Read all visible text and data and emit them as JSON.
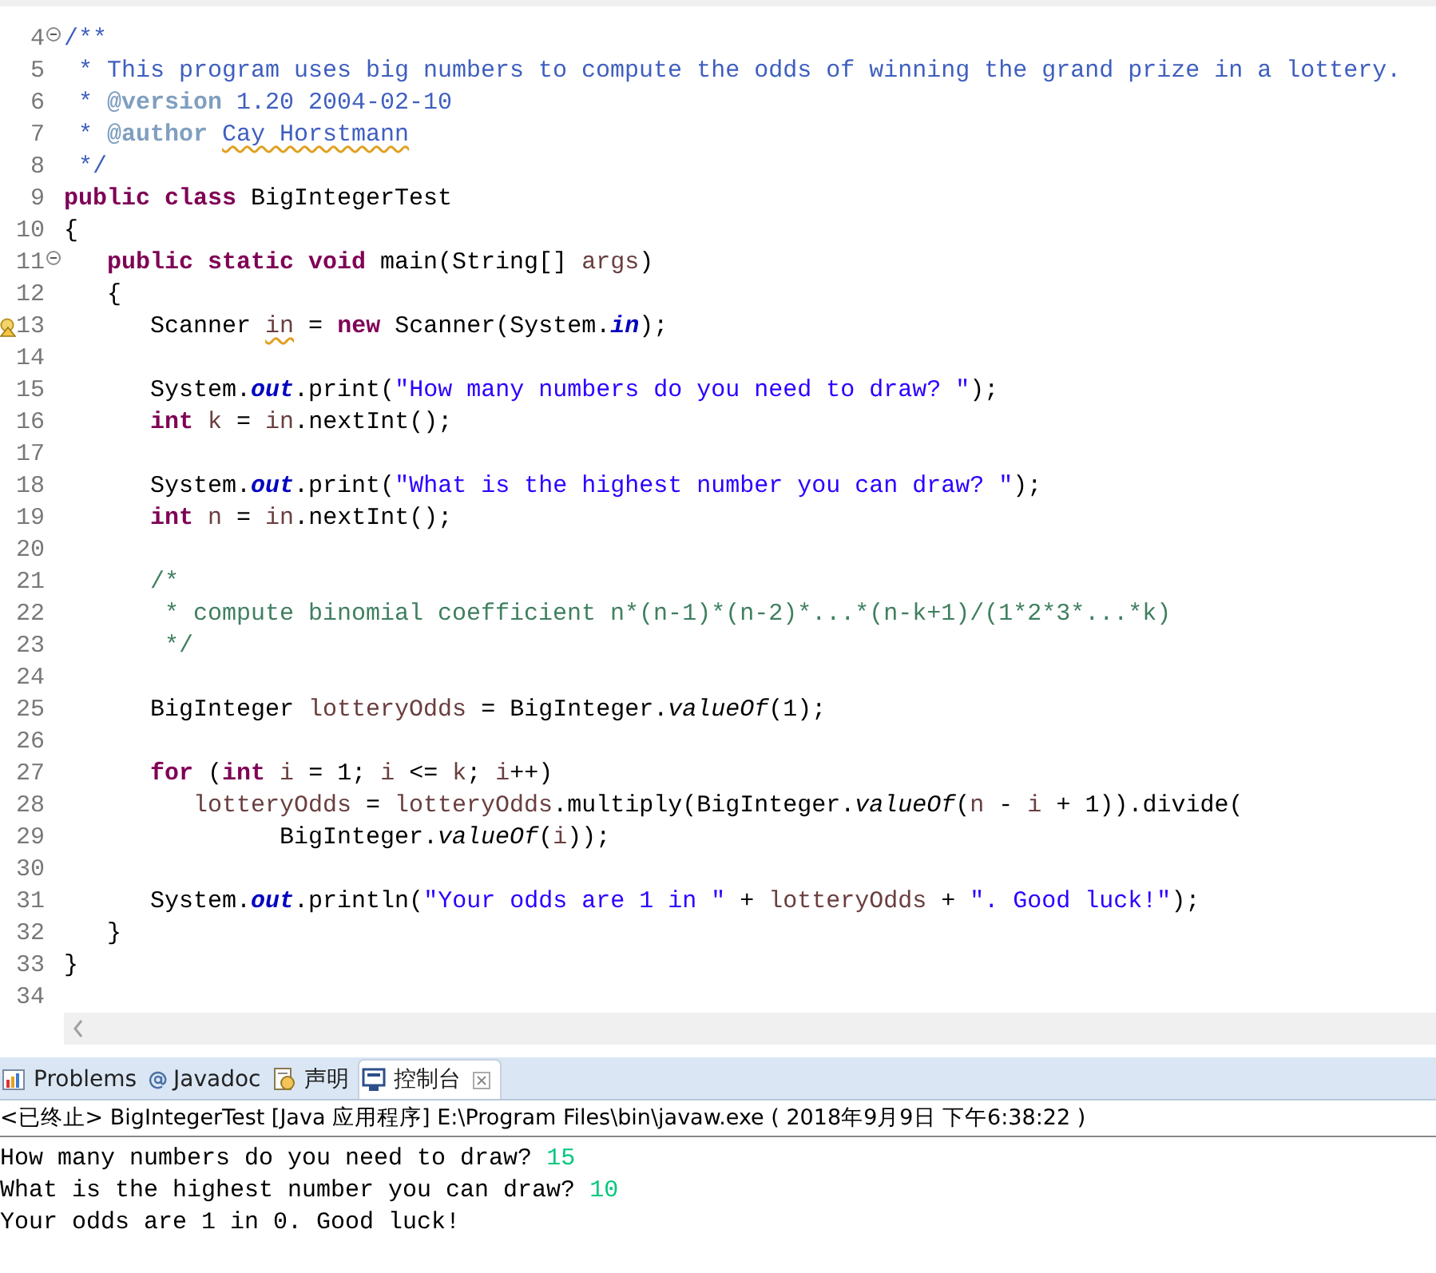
{
  "editor": {
    "lines": [
      {
        "number": "4",
        "fold": true,
        "warning": false,
        "tokens": [
          {
            "text": "/**",
            "kind": "doc"
          }
        ]
      },
      {
        "number": "5",
        "fold": false,
        "warning": false,
        "tokens": [
          {
            "text": " * This program uses big numbers to compute the odds of winning the grand prize in a lottery.",
            "kind": "doc"
          }
        ]
      },
      {
        "number": "6",
        "fold": false,
        "warning": false,
        "tokens": [
          {
            "text": " * ",
            "kind": "doc"
          },
          {
            "text": "@version",
            "kind": "doctag"
          },
          {
            "text": " 1.20 2004-02-10",
            "kind": "doc"
          }
        ]
      },
      {
        "number": "7",
        "fold": false,
        "warning": false,
        "tokens": [
          {
            "text": " * ",
            "kind": "doc"
          },
          {
            "text": "@author ",
            "kind": "doctag"
          },
          {
            "text": "Cay",
            "kind": "doc",
            "squiggle": true
          },
          {
            "text": " Horstmann",
            "kind": "doc",
            "squiggle": true
          }
        ]
      },
      {
        "number": "8",
        "fold": false,
        "warning": false,
        "tokens": [
          {
            "text": " */",
            "kind": "doc"
          }
        ]
      },
      {
        "number": "9",
        "fold": false,
        "warning": false,
        "tokens": [
          {
            "text": "public class",
            "kind": "keyword"
          },
          {
            "text": " BigIntegerTest",
            "kind": "plain"
          }
        ]
      },
      {
        "number": "10",
        "fold": false,
        "warning": false,
        "tokens": [
          {
            "text": "{",
            "kind": "plain"
          }
        ]
      },
      {
        "number": "11",
        "fold": true,
        "warning": false,
        "tokens": [
          {
            "text": "   public static void",
            "kind": "keyword"
          },
          {
            "text": " main(String[] ",
            "kind": "plain"
          },
          {
            "text": "args",
            "kind": "var"
          },
          {
            "text": ")",
            "kind": "plain"
          }
        ]
      },
      {
        "number": "12",
        "fold": false,
        "warning": false,
        "tokens": [
          {
            "text": "   {",
            "kind": "plain"
          }
        ]
      },
      {
        "number": "13",
        "fold": false,
        "warning": true,
        "tokens": [
          {
            "text": "      Scanner ",
            "kind": "plain"
          },
          {
            "text": "in",
            "kind": "var",
            "squiggle": true
          },
          {
            "text": " = ",
            "kind": "plain"
          },
          {
            "text": "new",
            "kind": "keyword"
          },
          {
            "text": " Scanner(System.",
            "kind": "plain"
          },
          {
            "text": "in",
            "kind": "field"
          },
          {
            "text": ");",
            "kind": "plain"
          }
        ]
      },
      {
        "number": "14",
        "fold": false,
        "warning": false
      },
      {
        "number": "15",
        "fold": false,
        "warning": false,
        "tokens": [
          {
            "text": "      System.",
            "kind": "plain"
          },
          {
            "text": "out",
            "kind": "field"
          },
          {
            "text": ".print(",
            "kind": "plain"
          },
          {
            "text": "\"How many numbers do you need to draw? \"",
            "kind": "string"
          },
          {
            "text": ");",
            "kind": "plain"
          }
        ]
      },
      {
        "number": "16",
        "fold": false,
        "warning": false,
        "tokens": [
          {
            "text": "      int",
            "kind": "keyword"
          },
          {
            "text": " k",
            "kind": "var"
          },
          {
            "text": " = ",
            "kind": "plain"
          },
          {
            "text": "in",
            "kind": "var"
          },
          {
            "text": ".nextInt();",
            "kind": "plain"
          }
        ]
      },
      {
        "number": "17",
        "fold": false,
        "warning": false
      },
      {
        "number": "18",
        "fold": false,
        "warning": false,
        "tokens": [
          {
            "text": "      System.",
            "kind": "plain"
          },
          {
            "text": "out",
            "kind": "field"
          },
          {
            "text": ".print(",
            "kind": "plain"
          },
          {
            "text": "\"What is the highest number you can draw? \"",
            "kind": "string"
          },
          {
            "text": ");",
            "kind": "plain"
          }
        ]
      },
      {
        "number": "19",
        "fold": false,
        "warning": false,
        "tokens": [
          {
            "text": "      int",
            "kind": "keyword"
          },
          {
            "text": " n",
            "kind": "var"
          },
          {
            "text": " = ",
            "kind": "plain"
          },
          {
            "text": "in",
            "kind": "var"
          },
          {
            "text": ".nextInt();",
            "kind": "plain"
          }
        ]
      },
      {
        "number": "20",
        "fold": false,
        "warning": false
      },
      {
        "number": "21",
        "fold": false,
        "warning": false,
        "tokens": [
          {
            "text": "      /*",
            "kind": "comment"
          }
        ]
      },
      {
        "number": "22",
        "fold": false,
        "warning": false,
        "tokens": [
          {
            "text": "       * compute binomial coefficient n*(n-1)*(n-2)*...*(n-k+1)/(1*2*3*...*k)",
            "kind": "comment"
          }
        ]
      },
      {
        "number": "23",
        "fold": false,
        "warning": false,
        "tokens": [
          {
            "text": "       */",
            "kind": "comment"
          }
        ]
      },
      {
        "number": "24",
        "fold": false,
        "warning": false
      },
      {
        "number": "25",
        "fold": false,
        "warning": false,
        "tokens": [
          {
            "text": "      BigInteger ",
            "kind": "plain"
          },
          {
            "text": "lotteryOdds",
            "kind": "var"
          },
          {
            "text": " = BigInteger.",
            "kind": "plain"
          },
          {
            "text": "valueOf",
            "kind": "static"
          },
          {
            "text": "(1);",
            "kind": "plain"
          }
        ]
      },
      {
        "number": "26",
        "fold": false,
        "warning": false
      },
      {
        "number": "27",
        "fold": false,
        "warning": false,
        "tokens": [
          {
            "text": "      for",
            "kind": "keyword"
          },
          {
            "text": " (",
            "kind": "plain"
          },
          {
            "text": "int",
            "kind": "keyword"
          },
          {
            "text": " i",
            "kind": "var"
          },
          {
            "text": " = 1; ",
            "kind": "plain"
          },
          {
            "text": "i",
            "kind": "var"
          },
          {
            "text": " <= ",
            "kind": "plain"
          },
          {
            "text": "k",
            "kind": "var"
          },
          {
            "text": "; ",
            "kind": "plain"
          },
          {
            "text": "i",
            "kind": "var"
          },
          {
            "text": "++)",
            "kind": "plain"
          }
        ]
      },
      {
        "number": "28",
        "fold": false,
        "warning": false,
        "tokens": [
          {
            "text": "         lotteryOdds",
            "kind": "var"
          },
          {
            "text": " = ",
            "kind": "plain"
          },
          {
            "text": "lotteryOdds",
            "kind": "var"
          },
          {
            "text": ".multiply(BigInteger.",
            "kind": "plain"
          },
          {
            "text": "valueOf",
            "kind": "static"
          },
          {
            "text": "(",
            "kind": "plain"
          },
          {
            "text": "n",
            "kind": "var"
          },
          {
            "text": " - ",
            "kind": "plain"
          },
          {
            "text": "i",
            "kind": "var"
          },
          {
            "text": " + 1)).divide(",
            "kind": "plain"
          }
        ]
      },
      {
        "number": "29",
        "fold": false,
        "warning": false,
        "tokens": [
          {
            "text": "               BigInteger.",
            "kind": "plain"
          },
          {
            "text": "valueOf",
            "kind": "static"
          },
          {
            "text": "(",
            "kind": "plain"
          },
          {
            "text": "i",
            "kind": "var"
          },
          {
            "text": "));",
            "kind": "plain"
          }
        ]
      },
      {
        "number": "30",
        "fold": false,
        "warning": false
      },
      {
        "number": "31",
        "fold": false,
        "warning": false,
        "tokens": [
          {
            "text": "      System.",
            "kind": "plain"
          },
          {
            "text": "out",
            "kind": "field"
          },
          {
            "text": ".println(",
            "kind": "plain"
          },
          {
            "text": "\"Your odds are 1 in \"",
            "kind": "string"
          },
          {
            "text": " + ",
            "kind": "plain"
          },
          {
            "text": "lotteryOdds",
            "kind": "var"
          },
          {
            "text": " + ",
            "kind": "plain"
          },
          {
            "text": "\". Good luck!\"",
            "kind": "string"
          },
          {
            "text": ");",
            "kind": "plain"
          }
        ]
      },
      {
        "number": "32",
        "fold": false,
        "warning": false,
        "tokens": [
          {
            "text": "   }",
            "kind": "plain"
          }
        ]
      },
      {
        "number": "33",
        "fold": false,
        "warning": false,
        "tokens": [
          {
            "text": "}",
            "kind": "plain"
          }
        ]
      },
      {
        "number": "34",
        "fold": false,
        "warning": false
      }
    ]
  },
  "tabs": [
    {
      "kind": "problems",
      "label": "Problems",
      "selected": false
    },
    {
      "kind": "javadoc",
      "label": "Javadoc",
      "selected": false
    },
    {
      "kind": "declaration",
      "label": "声明",
      "selected": false
    },
    {
      "kind": "console",
      "label": "控制台",
      "selected": true
    }
  ],
  "console": {
    "header": "<已终止> BigIntegerTest [Java 应用程序] E:\\Program Files\\bin\\javaw.exe ( 2018年9月9日 下午6:38:22 )",
    "lines": [
      [
        {
          "text": "How many numbers do you need to draw? ",
          "kind": "output"
        },
        {
          "text": "15",
          "kind": "input"
        }
      ],
      [
        {
          "text": "What is the highest number you can draw? ",
          "kind": "output"
        },
        {
          "text": "10",
          "kind": "input"
        }
      ],
      [
        {
          "text": "Your odds are 1 in 0. Good luck!",
          "kind": "output"
        }
      ]
    ]
  }
}
